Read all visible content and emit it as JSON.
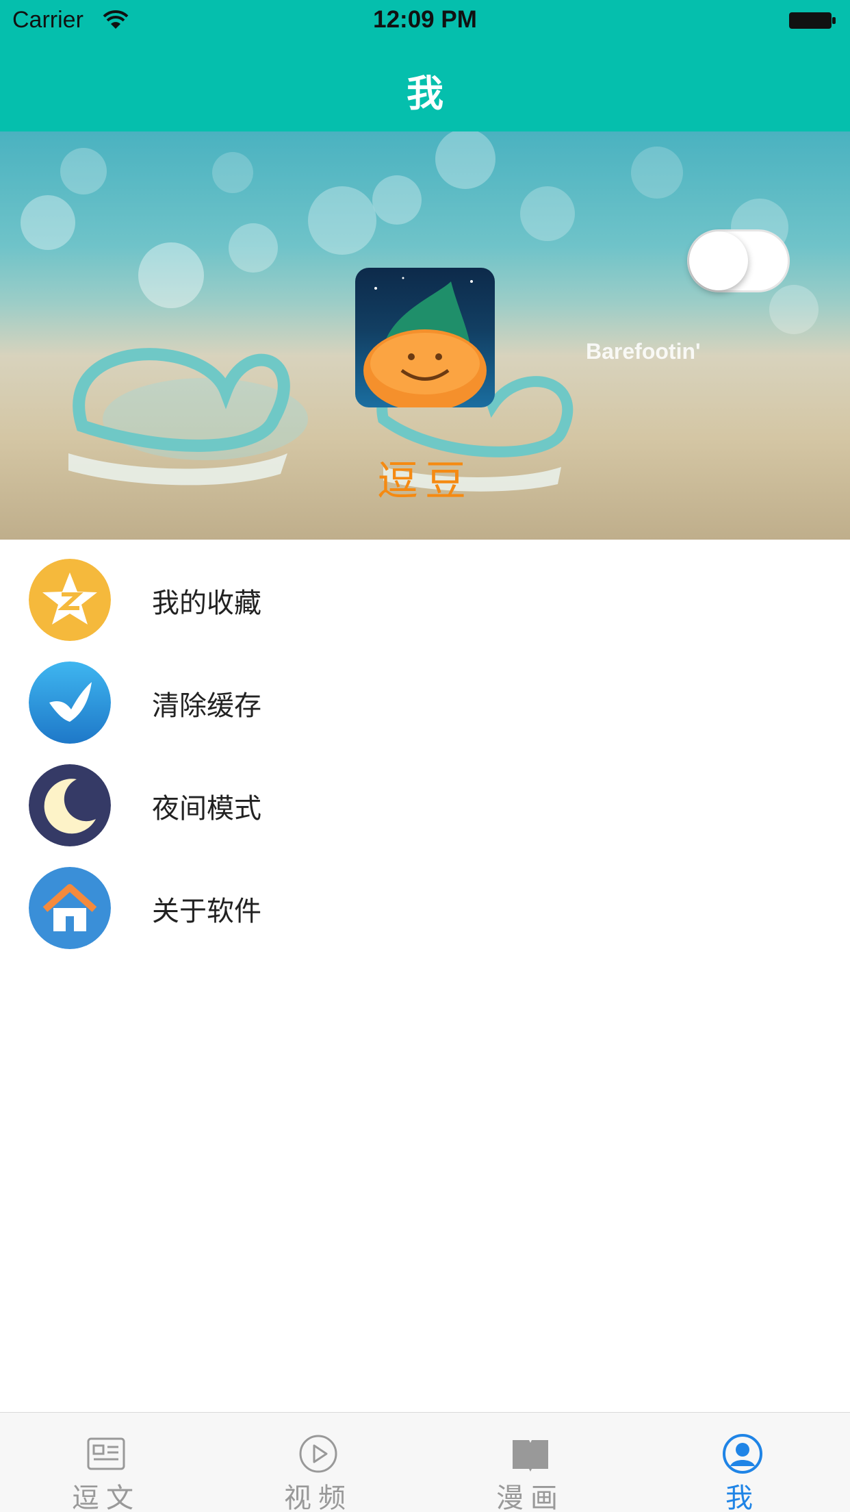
{
  "status_bar": {
    "carrier": "Carrier",
    "time": "12:09 PM"
  },
  "nav": {
    "title": "我"
  },
  "profile": {
    "nickname": "逗豆",
    "banner_watermark": "Barefootin'"
  },
  "menu": {
    "items": [
      {
        "label": "我的收藏",
        "icon": "qzone-star-icon"
      },
      {
        "label": "清除缓存",
        "icon": "bird-icon"
      },
      {
        "label": "夜间模式",
        "icon": "moon-icon",
        "toggle": false
      },
      {
        "label": "关于软件",
        "icon": "home-icon"
      }
    ]
  },
  "tabs": [
    {
      "label": "逗文",
      "icon": "news-icon",
      "active": false
    },
    {
      "label": "视频",
      "icon": "play-icon",
      "active": false
    },
    {
      "label": "漫画",
      "icon": "book-icon",
      "active": false
    },
    {
      "label": "我",
      "icon": "user-icon",
      "active": true
    }
  ],
  "colors": {
    "accent": "#05bfad",
    "nickname": "#f58a12",
    "tab_active": "#1f84e6",
    "tab_inactive": "#999999"
  }
}
